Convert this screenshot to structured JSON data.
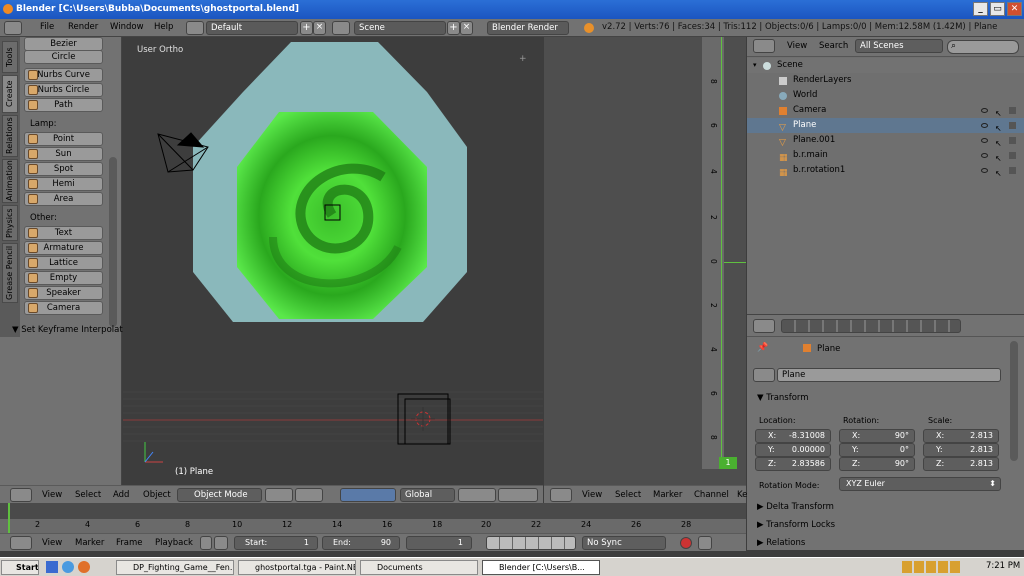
{
  "title": "Blender [C:\\Users\\Bubba\\Documents\\ghostportal.blend]",
  "window_buttons": [
    "_",
    "▭",
    "✕"
  ],
  "menu": [
    "File",
    "Render",
    "Window",
    "Help"
  ],
  "layout_field": "Default",
  "scene_field": "Scene",
  "engine": "Blender Render",
  "stats": "v2.72 | Verts:76 | Faces:34 | Tris:112 | Objects:0/6 | Lamps:0/0 | Mem:12.58M (1.42M) | Plane",
  "tool_tabs": [
    "Tools",
    "Create",
    "Relations",
    "Animation",
    "Physics",
    "Grease Pencil"
  ],
  "tools": {
    "top_items": [
      "Bezier",
      "Circle"
    ],
    "curve_items": [
      "Nurbs Curve",
      "Nurbs Circle",
      "Path"
    ],
    "lamp_label": "Lamp:",
    "lamp_items": [
      "Point",
      "Sun",
      "Spot",
      "Hemi",
      "Area"
    ],
    "other_label": "Other:",
    "other_items": [
      "Text",
      "Armature",
      "Lattice",
      "Empty",
      "Speaker",
      "Camera"
    ],
    "collapse": "▼ Set Keyframe Interpolati"
  },
  "viewport": {
    "label": "User Ortho",
    "object_label": "(1) Plane"
  },
  "view3d_header": {
    "menus": [
      "View",
      "Select",
      "Add",
      "Object"
    ],
    "mode": "Object Mode",
    "orientation": "Global"
  },
  "graph_header": {
    "menus": [
      "View",
      "Select",
      "Marker",
      "Channel",
      "Ke"
    ]
  },
  "graph_ruler": [
    "8",
    "6",
    "4",
    "2",
    "0",
    "2",
    "4",
    "6",
    "8"
  ],
  "graph_frame": "1",
  "outliner": {
    "menus": [
      "View",
      "Search"
    ],
    "scenes": "All Scenes",
    "rows": [
      "Scene",
      "RenderLayers",
      "World",
      "Camera",
      "Plane",
      "Plane.001",
      "b.r.main",
      "b.r.rotation1"
    ]
  },
  "properties": {
    "breadcrumb": "Plane",
    "object_name": "Plane",
    "transform_title": "Transform",
    "location_label": "Location:",
    "rotation_label": "Rotation:",
    "scale_label": "Scale:",
    "location": [
      {
        "axis": "X:",
        "value": "-8.31008"
      },
      {
        "axis": "Y:",
        "value": "0.00000"
      },
      {
        "axis": "Z:",
        "value": "2.83586"
      }
    ],
    "rotation": [
      {
        "axis": "X:",
        "value": "90°"
      },
      {
        "axis": "Y:",
        "value": "0°"
      },
      {
        "axis": "Z:",
        "value": "90°"
      }
    ],
    "scale": [
      {
        "axis": "X:",
        "value": "2.813"
      },
      {
        "axis": "Y:",
        "value": "2.813"
      },
      {
        "axis": "Z:",
        "value": "2.813"
      }
    ],
    "rotation_mode_label": "Rotation Mode:",
    "rotation_mode": "XYZ Euler",
    "panels": [
      "Delta Transform",
      "Transform Locks",
      "Relations"
    ]
  },
  "timeline": {
    "ticks": [
      "2",
      "4",
      "6",
      "8",
      "10",
      "12",
      "14",
      "16",
      "18",
      "20",
      "22",
      "24",
      "26",
      "28"
    ],
    "menus": [
      "View",
      "Marker",
      "Frame",
      "Playback"
    ],
    "start": "Start:",
    "start_value": "1",
    "end": "End:",
    "end_value": "90",
    "current": "1",
    "sync": "No Sync"
  },
  "taskbar": {
    "start": "Start",
    "tasks": [
      "DP_Fighting_Game__Fen...",
      "ghostportal.tga - Paint.NE...",
      "Documents",
      "Blender [C:\\Users\\B..."
    ],
    "clock": "7:21 PM"
  },
  "colors": {
    "sky_panel": "#8ab8bb",
    "portal_green": "#3ccf2a",
    "title_blue": "#1f5fd0",
    "header_gray": "#727272"
  }
}
